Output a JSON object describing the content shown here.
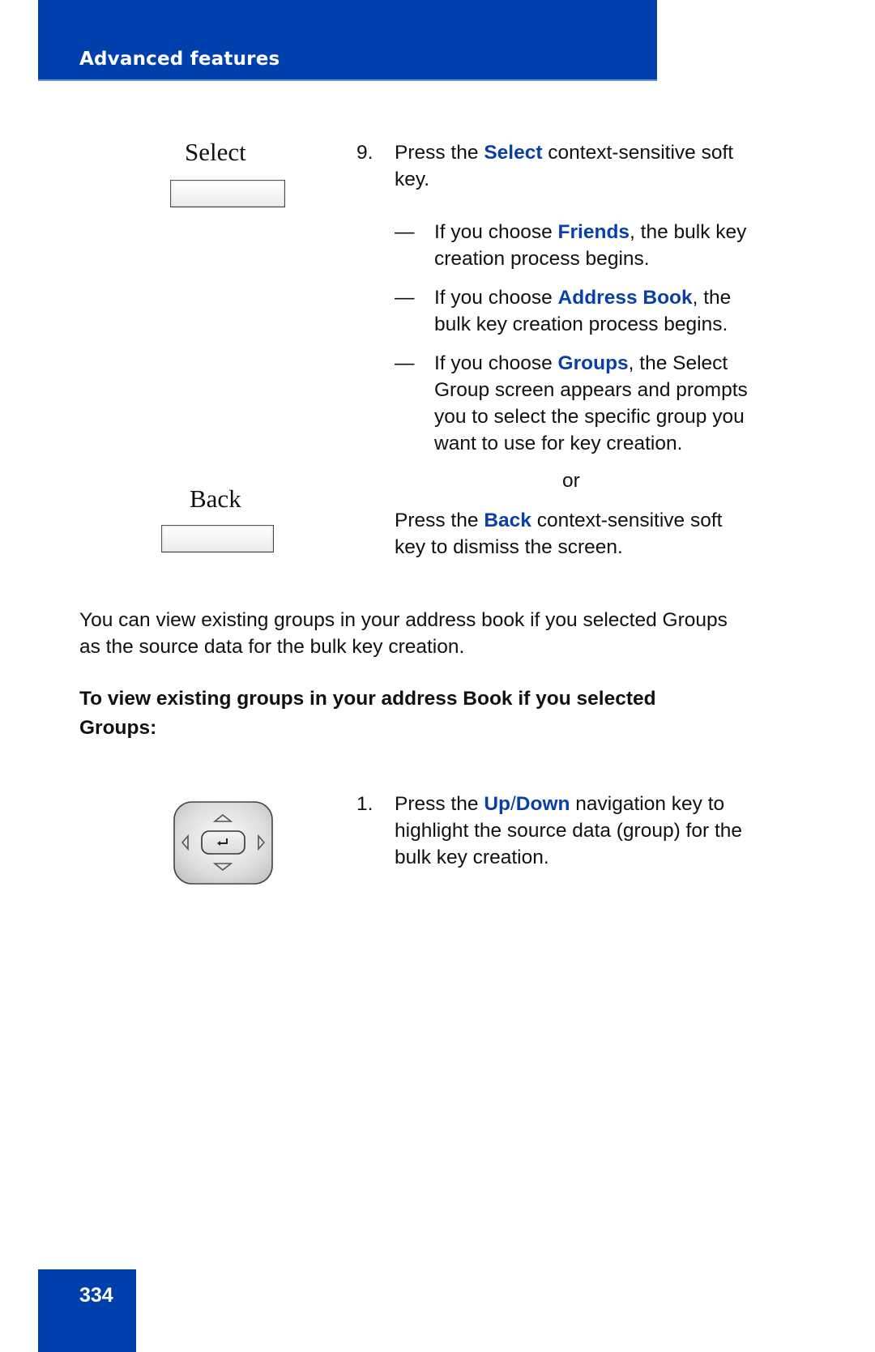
{
  "header": {
    "section_title": "Advanced features"
  },
  "soft_keys": {
    "select_label": "Select",
    "back_label": "Back"
  },
  "step9": {
    "number": "9.",
    "line1_pre": "Press the ",
    "line1_key": "Select",
    "line1_post": " context-sensitive soft",
    "line2": "key.",
    "bullets": [
      {
        "dash": "—",
        "pre": "If you choose ",
        "key": "Friends",
        "post": ", the bulk key",
        "rest": [
          "creation process begins."
        ]
      },
      {
        "dash": "—",
        "pre": "If you choose ",
        "key": "Address Book",
        "post": ", the",
        "rest": [
          "bulk key creation process begins."
        ]
      },
      {
        "dash": "—",
        "pre": "If you choose ",
        "key": "Groups",
        "post": ", the Select",
        "rest": [
          "Group screen appears and prompts",
          "you to select the specific group you",
          "want to use for key creation."
        ]
      }
    ],
    "or": "or",
    "alt_line1_pre": "Press the ",
    "alt_line1_key": "Back",
    "alt_line1_post": " context-sensitive soft",
    "alt_line2": "key to dismiss the screen."
  },
  "intro": {
    "line1": "You can view existing groups in your address book if you selected Groups",
    "line2": "as the source data for the bulk key creation."
  },
  "procedure_heading": {
    "line1": "To view existing groups in your address Book if you selected",
    "line2": "Groups:"
  },
  "step1": {
    "number": "1.",
    "line1_pre": "Press the ",
    "line1_key_a": "Up",
    "line1_slash": "/",
    "line1_key_b": "Down",
    "line1_post": " navigation key to",
    "line2": "highlight the source data (group) for the",
    "line3": "bulk key creation."
  },
  "colors": {
    "brand_blue": "#0040ad",
    "keyword_blue": "#0a3fa8"
  },
  "footer": {
    "page_number": "334"
  }
}
